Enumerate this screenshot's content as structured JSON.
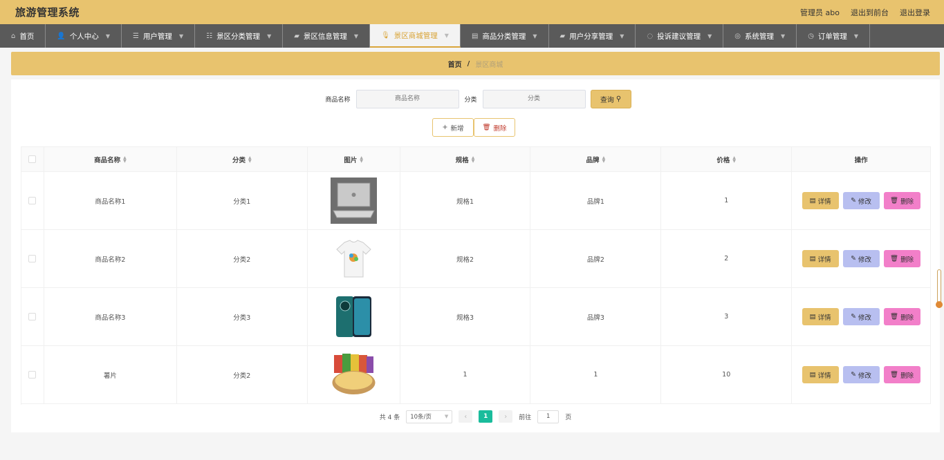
{
  "app": {
    "title": "旅游管理系统"
  },
  "topbar": {
    "user": "管理员 abo",
    "to_front": "退出到前台",
    "logout": "退出登录"
  },
  "nav": [
    {
      "label": "首页",
      "icon": "home-icon",
      "has_menu": false
    },
    {
      "label": "个人中心",
      "icon": "user-icon",
      "has_menu": true
    },
    {
      "label": "用户管理",
      "icon": "list-icon",
      "has_menu": true
    },
    {
      "label": "景区分类管理",
      "icon": "sliders-icon",
      "has_menu": true
    },
    {
      "label": "景区信息管理",
      "icon": "briefcase-icon",
      "has_menu": true
    },
    {
      "label": "景区商城管理",
      "icon": "mic-icon",
      "has_menu": true,
      "active": true
    },
    {
      "label": "商品分类管理",
      "icon": "clipboard-icon",
      "has_menu": true
    },
    {
      "label": "用户分享管理",
      "icon": "briefcase-icon",
      "has_menu": true
    },
    {
      "label": "投诉建议管理",
      "icon": "circle-icon",
      "has_menu": true
    },
    {
      "label": "系统管理",
      "icon": "compass-icon",
      "has_menu": true
    },
    {
      "label": "订单管理",
      "icon": "clock-icon",
      "has_menu": true
    }
  ],
  "breadcrumb": {
    "home": "首页",
    "sep": "/",
    "current": "景区商城"
  },
  "search": {
    "name_label": "商品名称",
    "name_placeholder": "商品名称",
    "category_label": "分类",
    "category_placeholder": "分类",
    "query_button": "查询"
  },
  "actions": {
    "add": "新增",
    "delete": "删除"
  },
  "table": {
    "headers": [
      "商品名称",
      "分类",
      "图片",
      "规格",
      "品牌",
      "价格",
      "操作"
    ],
    "rows": [
      {
        "name": "商品名称1",
        "category": "分类1",
        "image": "laptop",
        "spec": "规格1",
        "brand": "品牌1",
        "price": "1"
      },
      {
        "name": "商品名称2",
        "category": "分类2",
        "image": "tshirt",
        "spec": "规格2",
        "brand": "品牌2",
        "price": "2"
      },
      {
        "name": "商品名称3",
        "category": "分类3",
        "image": "phone",
        "spec": "规格3",
        "brand": "品牌3",
        "price": "3"
      },
      {
        "name": "薯片",
        "category": "分类2",
        "image": "chips",
        "spec": "1",
        "brand": "1",
        "price": "10"
      }
    ],
    "row_ops": {
      "detail": "详情",
      "edit": "修改",
      "delete": "删除"
    }
  },
  "pager": {
    "total": "共 4 条",
    "page_size": "10条/页",
    "current_page": "1",
    "goto_label": "前往",
    "goto_value": "1",
    "page_unit": "页"
  },
  "colors": {
    "accent": "#e8c36e",
    "nav_bg": "#5a5a5a",
    "edit": "#b8bff0",
    "delete": "#f27fc9",
    "pager_active": "#1abc9c"
  }
}
